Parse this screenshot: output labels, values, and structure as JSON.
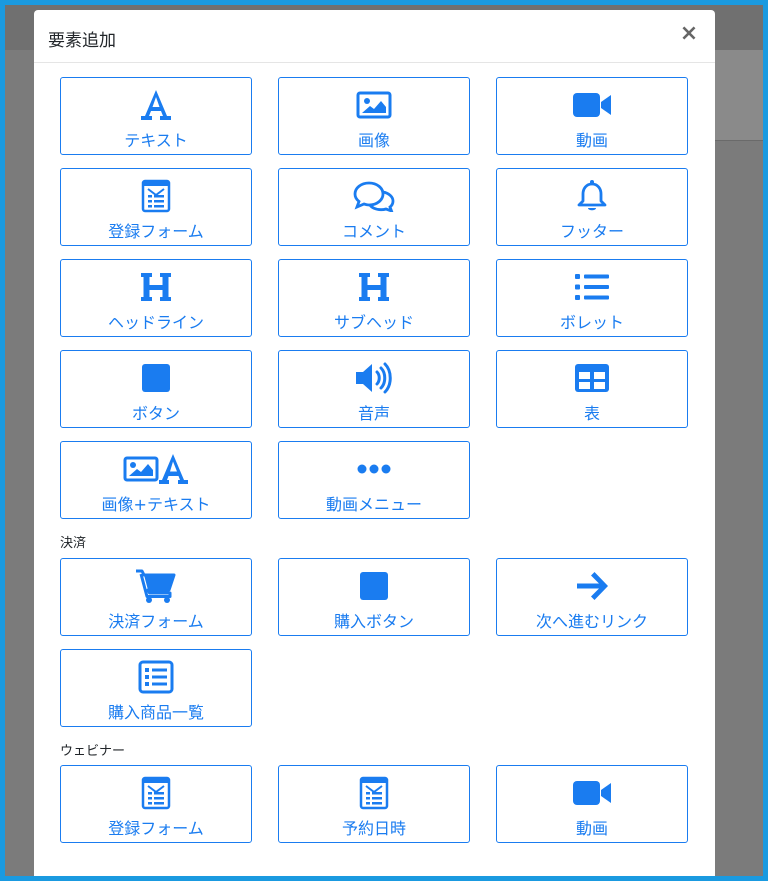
{
  "modal": {
    "title": "要素追加",
    "close_label": "×"
  },
  "colors": {
    "accent": "#1a7cf0",
    "frame": "#1a9ae0",
    "backdrop": "#7b7b7b"
  },
  "sections": [
    {
      "label": "",
      "items": [
        {
          "label": "テキスト",
          "icon": "text-a-icon"
        },
        {
          "label": "画像",
          "icon": "image-icon"
        },
        {
          "label": "動画",
          "icon": "video-camera-icon"
        },
        {
          "label": "登録フォーム",
          "icon": "form-icon"
        },
        {
          "label": "コメント",
          "icon": "comments-icon"
        },
        {
          "label": "フッター",
          "icon": "bell-icon"
        },
        {
          "label": "ヘッドライン",
          "icon": "heading-icon"
        },
        {
          "label": "サブヘッド",
          "icon": "heading-icon"
        },
        {
          "label": "ボレット",
          "icon": "list-icon"
        },
        {
          "label": "ボタン",
          "icon": "square-icon"
        },
        {
          "label": "音声",
          "icon": "volume-icon"
        },
        {
          "label": "表",
          "icon": "table-icon"
        },
        {
          "label": "画像+テキスト",
          "icon": "image-text-icon"
        },
        {
          "label": "動画メニュー",
          "icon": "ellipsis-icon"
        }
      ]
    },
    {
      "label": "決済",
      "items": [
        {
          "label": "決済フォーム",
          "icon": "cart-icon"
        },
        {
          "label": "購入ボタン",
          "icon": "square-icon"
        },
        {
          "label": "次へ進むリンク",
          "icon": "arrow-right-icon"
        },
        {
          "label": "購入商品一覧",
          "icon": "list-box-icon"
        }
      ]
    },
    {
      "label": "ウェビナー",
      "items": [
        {
          "label": "登録フォーム",
          "icon": "form-icon"
        },
        {
          "label": "予約日時",
          "icon": "form-icon"
        },
        {
          "label": "動画",
          "icon": "video-camera-icon"
        }
      ]
    }
  ]
}
